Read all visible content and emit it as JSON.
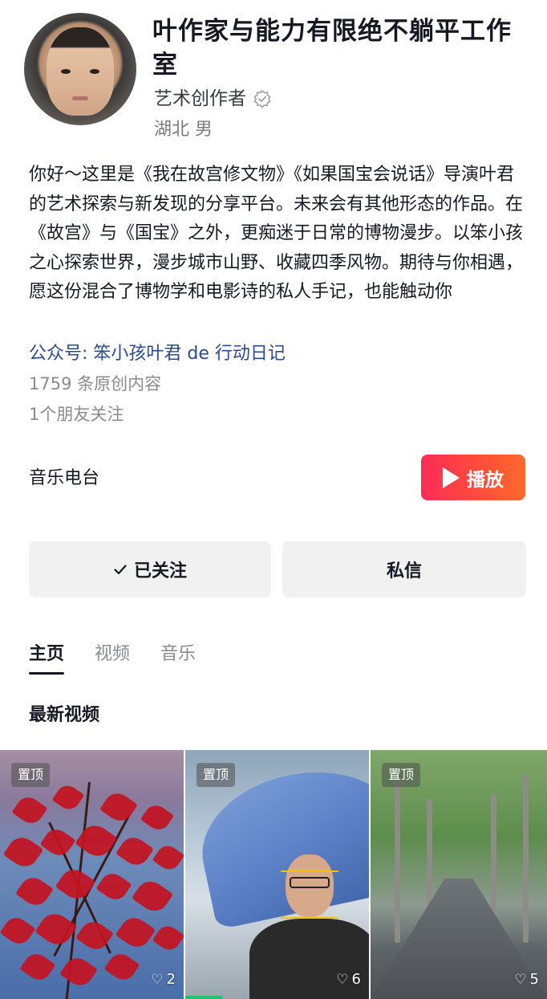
{
  "profile": {
    "name": "叶作家与能力有限绝不躺平工作室",
    "role": "艺术创作者",
    "location": "湖北  男"
  },
  "bio": {
    "text": "你好～这里是《我在故宫修文物》《如果国宝会说话》导演叶君的艺术探索与新发现的分享平台。未来会有其他形态的作品。在《故宫》与《国宝》之外，更痴迷于日常的博物漫步。以笨小孩之心探索世界，漫步城市山野、收藏四季风物。期待与你相遇，愿这份混合了博物学和电影诗的私人手记，也能触动你",
    "wechat": "公众号: 笨小孩叶君 de 行动日记",
    "original_count": "1759 条原创内容",
    "friends": "1个朋友关注"
  },
  "radio": {
    "label": "音乐电台",
    "play_label": "播放"
  },
  "actions": {
    "follow_label": "已关注",
    "message_label": "私信"
  },
  "tabs": [
    {
      "label": "主页",
      "active": true
    },
    {
      "label": "视频",
      "active": false
    },
    {
      "label": "音乐",
      "active": false
    }
  ],
  "videos": {
    "section_title": "最新视频",
    "items": [
      {
        "pin_label": "置顶",
        "likes": "2"
      },
      {
        "pin_label": "置顶",
        "likes": "6"
      },
      {
        "pin_label": "置顶",
        "likes": "5"
      }
    ]
  },
  "colors": {
    "accent": "#fe2c55",
    "link": "#2a4b8d"
  }
}
